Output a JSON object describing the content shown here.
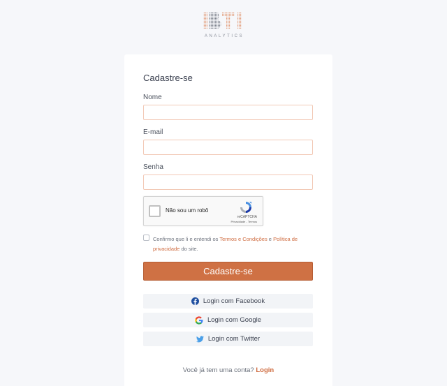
{
  "logo": {
    "mark_text": "IBTI",
    "sub_text": "ANALYTICS"
  },
  "form": {
    "title": "Cadastre-se",
    "name_label": "Nome",
    "name_value": "",
    "email_label": "E-mail",
    "email_value": "",
    "password_label": "Senha",
    "password_value": ""
  },
  "recaptcha": {
    "label": "Não sou um robô",
    "brand": "reCAPTCHA",
    "links": "Privacidade - Termos"
  },
  "terms": {
    "prefix": "Confirmo que li e entendi os ",
    "terms_link": "Termos e Condições",
    "middle": " e ",
    "privacy_link": "Política de privacidade",
    "suffix": " do site."
  },
  "submit_label": "Cadastre-se",
  "social": {
    "facebook_label": "Login com Facebook",
    "google_label": "Login com Google",
    "twitter_label": "Login com Twitter"
  },
  "footer": {
    "prompt": "Você já tem uma conta? ",
    "login_link": "Login"
  },
  "colors": {
    "accent": "#cf7144",
    "link": "#cf6b3f",
    "input_border": "#f2c9b6",
    "social_bg": "#f2f4f7"
  }
}
